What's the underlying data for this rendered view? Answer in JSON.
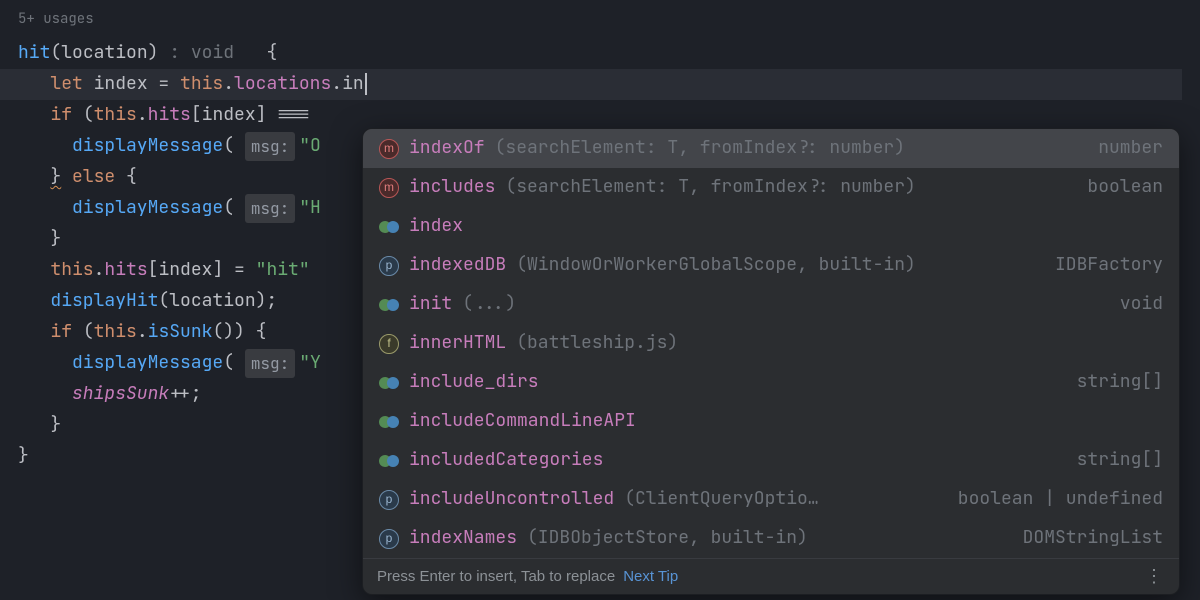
{
  "usages": "5+ usages",
  "code": {
    "fn_name": "hit",
    "param": "location",
    "ret_hint": ": void",
    "let_kw": "let",
    "var_index": "index",
    "this": "this",
    "locations": "locations",
    "typed": "in",
    "if_kw": "if",
    "hits": "hits",
    "eq": "===",
    "msg_hint": "msg:",
    "str_o": "\"O",
    "else_kw": "else",
    "str_h": "\"H",
    "str_hit": "\"hit\"",
    "displayMessage": "displayMessage",
    "displayHit": "displayHit",
    "isSunk": "isSunk",
    "str_y": "\"Y",
    "shipsSunk": "shipsSunk"
  },
  "completion": {
    "items": [
      {
        "icon": "m",
        "name": "indexOf",
        "sig": "(searchElement: T, fromIndex?: number)",
        "type": "number",
        "selected": true
      },
      {
        "icon": "m",
        "name": "includes",
        "sig": "(searchElement: T, fromIndex?: number)",
        "type": "boolean"
      },
      {
        "icon": "var",
        "name": "index",
        "sig": "",
        "type": ""
      },
      {
        "icon": "p",
        "name": "indexedDB",
        "sig": " (WindowOrWorkerGlobalScope, built-in)",
        "type": "IDBFactory"
      },
      {
        "icon": "var",
        "name": "init",
        "sig": "(...)",
        "type": "void"
      },
      {
        "icon": "f",
        "name": "innerHTML",
        "sig": " (battleship.js)",
        "type": ""
      },
      {
        "icon": "var",
        "name": "include_dirs",
        "sig": "",
        "type": "string[]"
      },
      {
        "icon": "var",
        "name": "includeCommandLineAPI",
        "sig": "",
        "type": ""
      },
      {
        "icon": "var",
        "name": "includedCategories",
        "sig": "",
        "type": "string[]"
      },
      {
        "icon": "p",
        "name": "includeUncontrolled",
        "sig": " (ClientQueryOptio…",
        "type": "boolean | undefined"
      },
      {
        "icon": "p",
        "name": "indexNames",
        "sig": " (IDBObjectStore, built-in)",
        "type": "DOMStringList"
      }
    ],
    "footer_hint": "Press Enter to insert, Tab to replace",
    "footer_link": "Next Tip"
  }
}
